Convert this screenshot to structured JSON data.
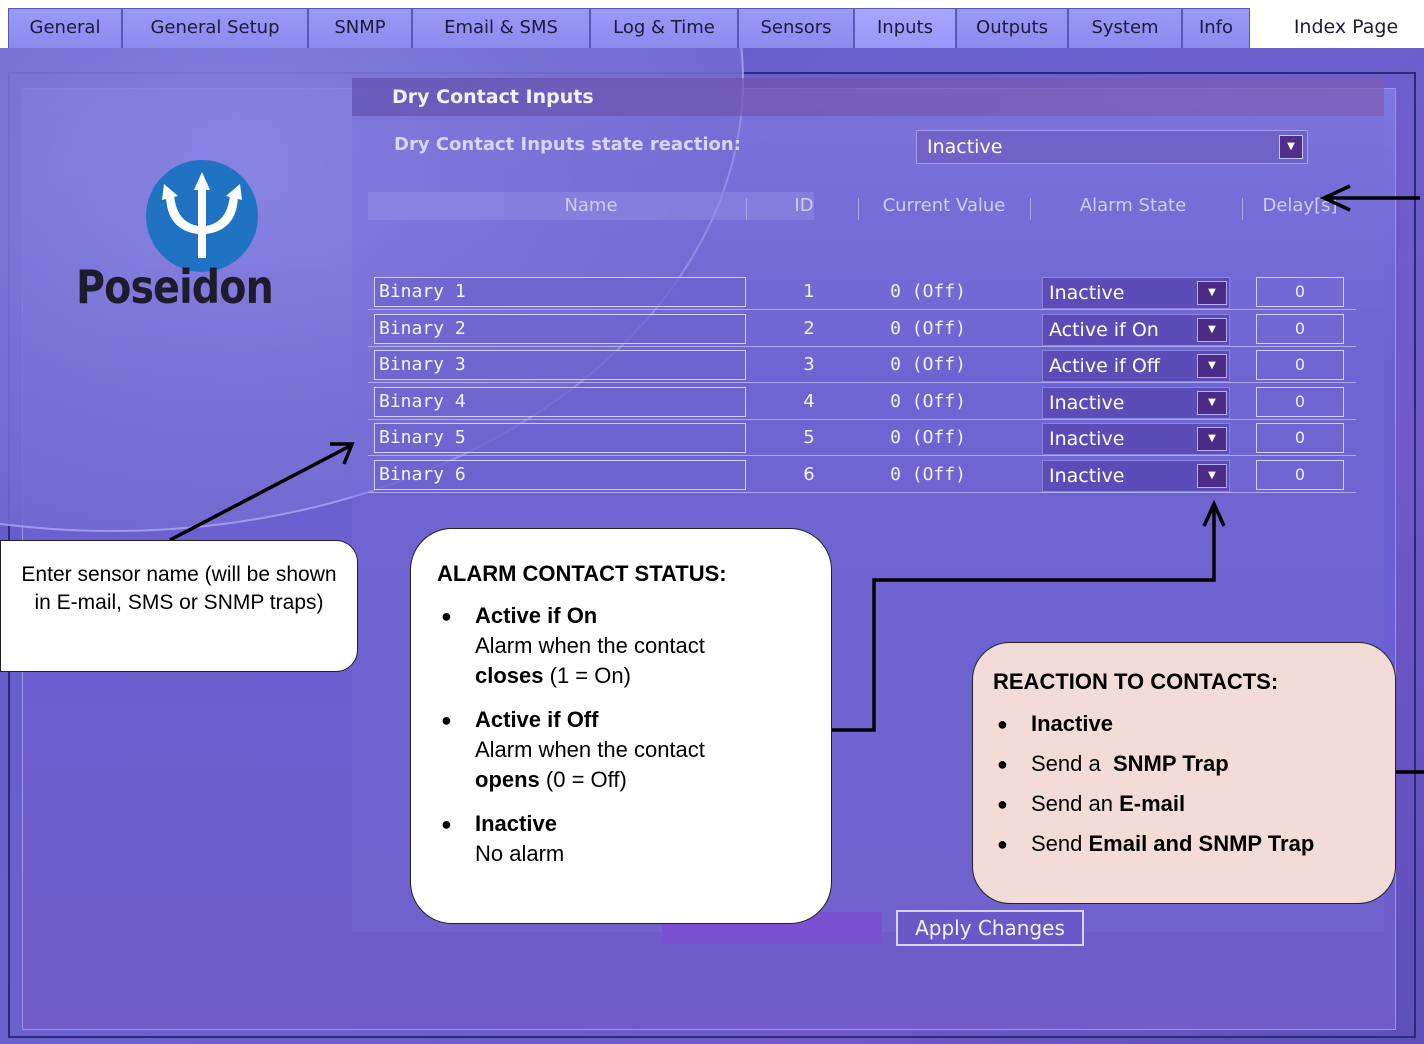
{
  "tabs": [
    {
      "label": "General",
      "active": false
    },
    {
      "label": "General Setup",
      "active": false
    },
    {
      "label": "SNMP",
      "active": false
    },
    {
      "label": "Email & SMS",
      "active": false
    },
    {
      "label": "Log & Time",
      "active": false
    },
    {
      "label": "Sensors",
      "active": false
    },
    {
      "label": "Inputs",
      "active": true
    },
    {
      "label": "Outputs",
      "active": false
    },
    {
      "label": "System",
      "active": false
    },
    {
      "label": "Info",
      "active": false
    }
  ],
  "index_page_label": "Index Page",
  "logo": {
    "text": "Poseidon",
    "icon": "trident-icon"
  },
  "section": {
    "title": "Dry Contact Inputs",
    "reaction_label": "Dry Contact Inputs state reaction:",
    "reaction_value": "Inactive"
  },
  "table": {
    "headers": {
      "name": "Name",
      "id": "ID",
      "current": "Current Value",
      "alarm": "Alarm State",
      "delay": "Delay[s]"
    },
    "rows": [
      {
        "name": "Binary 1",
        "id": "1",
        "value": "0 (Off)",
        "alarm": "Inactive",
        "delay": "0"
      },
      {
        "name": "Binary 2",
        "id": "2",
        "value": "0 (Off)",
        "alarm": "Active if On",
        "delay": "0"
      },
      {
        "name": "Binary 3",
        "id": "3",
        "value": "0 (Off)",
        "alarm": "Active if Off",
        "delay": "0"
      },
      {
        "name": "Binary 4",
        "id": "4",
        "value": "0 (Off)",
        "alarm": "Inactive",
        "delay": "0"
      },
      {
        "name": "Binary 5",
        "id": "5",
        "value": "0 (Off)",
        "alarm": "Inactive",
        "delay": "0"
      },
      {
        "name": "Binary 6",
        "id": "6",
        "value": "0 (Off)",
        "alarm": "Inactive",
        "delay": "0"
      }
    ]
  },
  "apply_button": "Apply Changes",
  "callouts": {
    "name_hint": "Enter sensor name (will be shown in E-mail, SMS or SNMP traps)",
    "alarm": {
      "title": "ALARM CONTACT STATUS:",
      "items": [
        {
          "head": "Active if On",
          "line1": "Alarm when the contact",
          "bold": "closes",
          "rest": " (1 = On)"
        },
        {
          "head": "Active if Off",
          "line1": "Alarm when the contact",
          "bold": "opens",
          "rest": " (0 = Off)"
        },
        {
          "head": "Inactive",
          "line1": "No alarm",
          "bold": "",
          "rest": ""
        }
      ]
    },
    "reaction": {
      "title": "REACTION TO CONTACTS:",
      "items": [
        {
          "pre": "",
          "bold": "Inactive"
        },
        {
          "pre": "Send a  ",
          "bold": "SNMP Trap"
        },
        {
          "pre": "Send an ",
          "bold": "E-mail"
        },
        {
          "pre": "Send ",
          "bold": "Email and SNMP Trap"
        }
      ]
    }
  },
  "colors": {
    "accent": "#6b62d0",
    "panel": "#5e57c2",
    "reaction_callout": "#f3dcd8",
    "logo_blue": "#1f73c2"
  }
}
